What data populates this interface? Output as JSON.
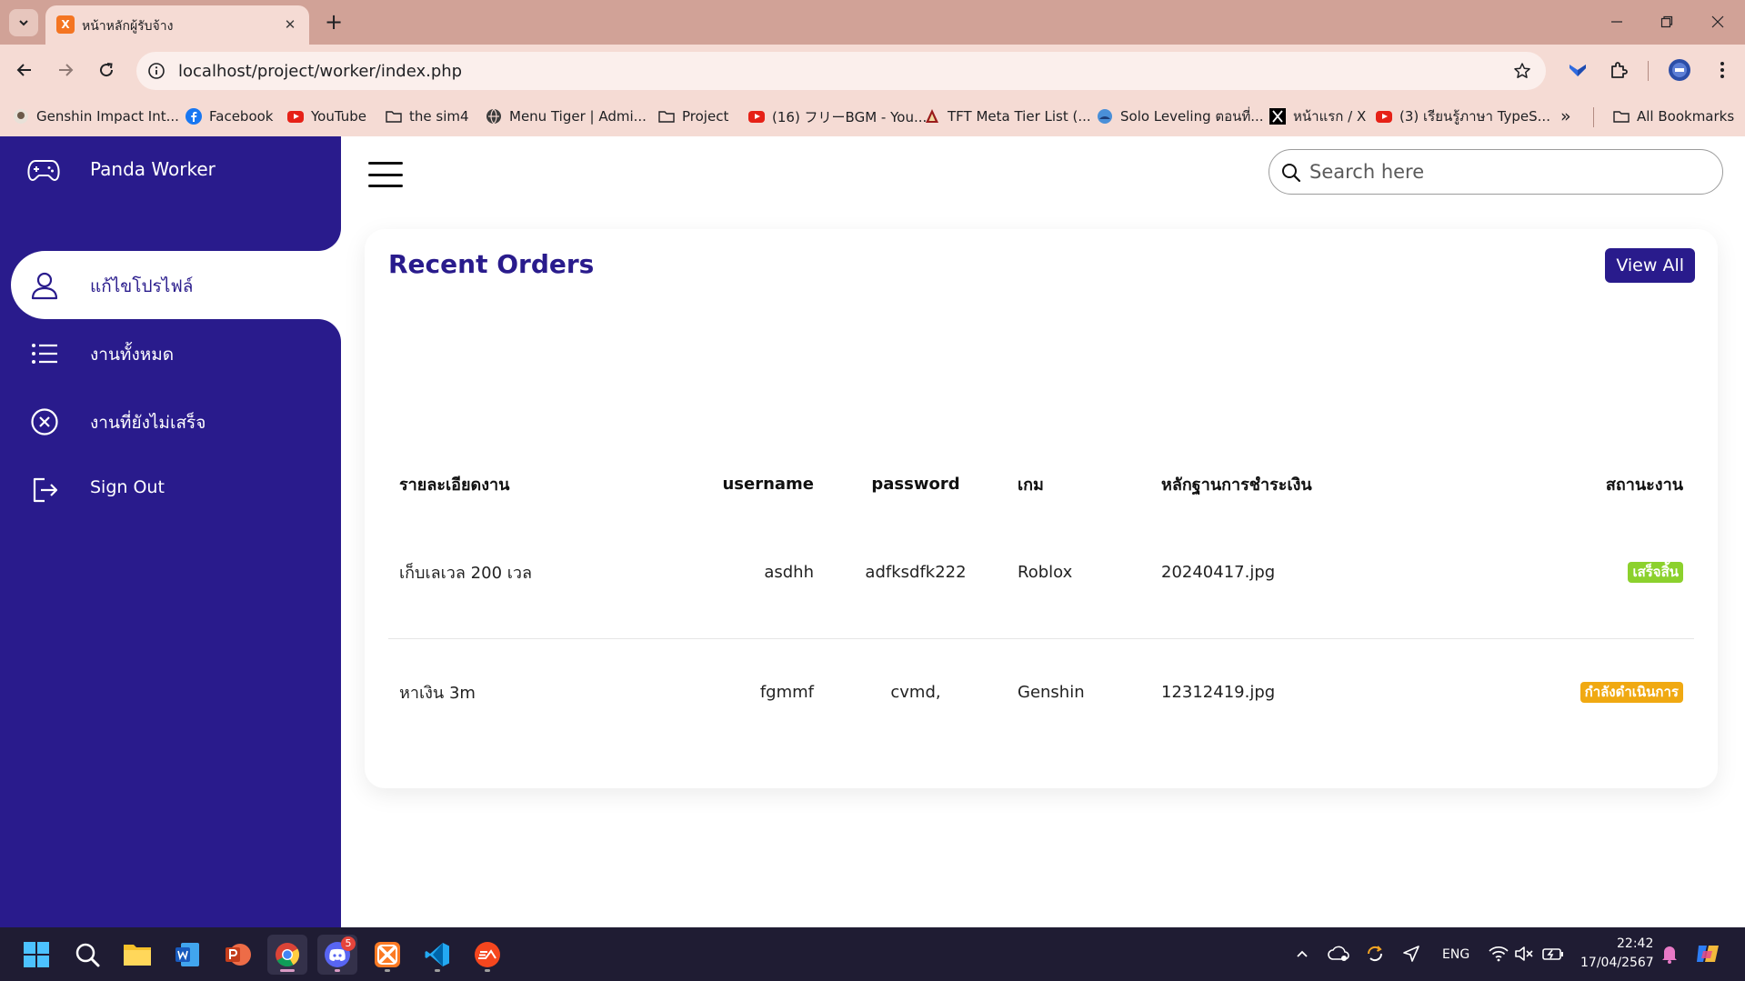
{
  "browser": {
    "tab_title": "หน้าหลักผู้รับจ้าง",
    "tab_favicon_text": "X",
    "url": "localhost/project/worker/index.php",
    "bookmarks": [
      {
        "label": "Genshin Impact Int...",
        "icon": "genshin-icon"
      },
      {
        "label": "Facebook",
        "icon": "facebook-icon"
      },
      {
        "label": "YouTube",
        "icon": "youtube-icon"
      },
      {
        "label": "the sim4",
        "icon": "folder-icon"
      },
      {
        "label": "Menu Tiger | Admi...",
        "icon": "globe-icon"
      },
      {
        "label": "Project",
        "icon": "folder-icon"
      },
      {
        "label": "(16) フリーBGM - You...",
        "icon": "youtube-icon"
      },
      {
        "label": "TFT Meta Tier List (...",
        "icon": "tft-icon"
      },
      {
        "label": "Solo Leveling ตอนที่...",
        "icon": "solo-leveling-icon"
      },
      {
        "label": "หน้าแรก / X",
        "icon": "x-icon"
      },
      {
        "label": "(3) เรียนรู้ภาษา TypeS...",
        "icon": "youtube-icon"
      }
    ],
    "more_bookmarks": "»",
    "all_bookmarks": "All Bookmarks"
  },
  "sidebar": {
    "brand": "Panda Worker",
    "items": [
      {
        "label": "แก้ไขโปรไฟล์",
        "icon": "person-icon",
        "active": true
      },
      {
        "label": "งานทั้งหมด",
        "icon": "list-icon",
        "active": false
      },
      {
        "label": "งานที่ยังไม่เสร็จ",
        "icon": "close-circle-icon",
        "active": false
      },
      {
        "label": "Sign Out",
        "icon": "sign-out-icon",
        "active": false
      }
    ]
  },
  "topbar": {
    "search_placeholder": "Search here"
  },
  "orders": {
    "title": "Recent Orders",
    "view_all": "View All",
    "columns": [
      "รายละเอียดงาน",
      "username",
      "password",
      "เกม",
      "หลักฐานการชำระเงิน",
      "สถานะงาน"
    ],
    "rows": [
      {
        "detail": "เก็บเลเวล 200 เวล",
        "username": "asdhh",
        "password": "adfksdfk222",
        "game": "Roblox",
        "proof": "20240417.jpg",
        "status": "เสร็จสิ้น",
        "status_color": "#8cd12d"
      },
      {
        "detail": "หาเงิน 3m",
        "username": "fgmmf",
        "password": "cvmd,",
        "game": "Genshin",
        "proof": "12312419.jpg",
        "status": "กำลังดำเนินการ",
        "status_color": "#f0a912"
      }
    ]
  },
  "taskbar": {
    "apps": [
      "windows-start-icon",
      "search-icon",
      "file-explorer-icon",
      "word-icon",
      "powerpoint-icon",
      "chrome-icon",
      "discord-icon",
      "xampp-icon",
      "vscode-icon",
      "ea-icon"
    ],
    "discord_badge": "5",
    "lang": "ENG",
    "time": "22:42",
    "date": "17/04/2567"
  },
  "colors": {
    "sidebar": "#291b8c",
    "chrome": "#d1a297",
    "toolbar": "#f5dbd4",
    "taskbar": "#1f1c33"
  }
}
